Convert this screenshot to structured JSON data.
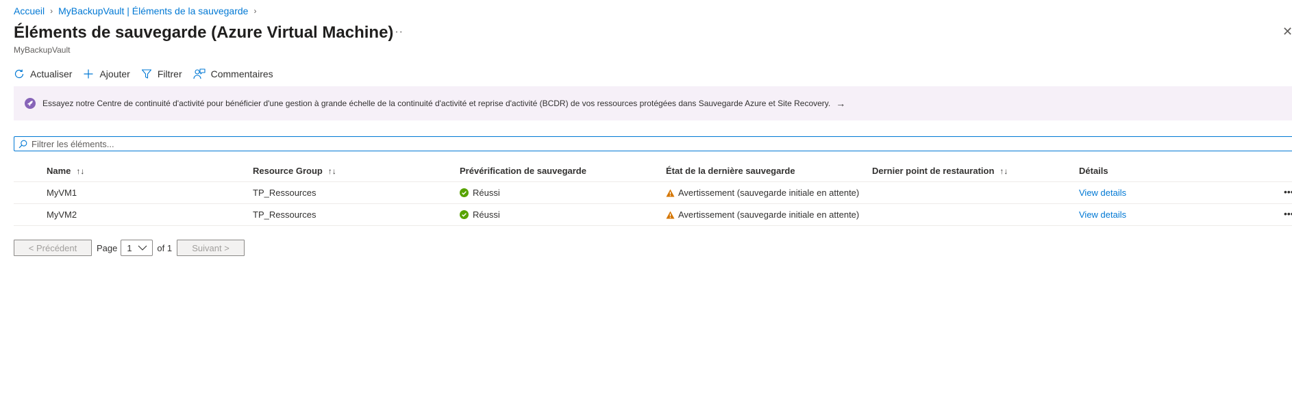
{
  "breadcrumb": {
    "home": "Accueil",
    "vault": "MyBackupVault | Éléments de la sauvegarde"
  },
  "header": {
    "title": "Éléments de sauvegarde (Azure Virtual Machine)",
    "subtitle": "MyBackupVault",
    "more": "···"
  },
  "toolbar": {
    "refresh": "Actualiser",
    "add": "Ajouter",
    "filter": "Filtrer",
    "feedback": "Commentaires"
  },
  "banner": {
    "text": "Essayez notre Centre de continuité d'activité pour bénéficier d'une gestion à grande échelle de la continuité d'activité et reprise d'activité (BCDR) de vos ressources protégées dans Sauvegarde Azure et Site Recovery."
  },
  "filter": {
    "placeholder": "Filtrer les éléments..."
  },
  "table": {
    "columns": [
      "Name",
      "Resource Group",
      "Prévérification de sauvegarde",
      "État de la dernière sauvegarde",
      "Dernier point de restauration",
      "Détails"
    ],
    "rows": [
      {
        "name": "MyVM1",
        "resource_group": "TP_Ressources",
        "precheck": "Réussi",
        "last_backup": "Avertissement (sauvegarde initiale en attente)",
        "restore_point": "",
        "details": "View details"
      },
      {
        "name": "MyVM2",
        "resource_group": "TP_Ressources",
        "precheck": "Réussi",
        "last_backup": "Avertissement (sauvegarde initiale en attente)",
        "restore_point": "",
        "details": "View details"
      }
    ]
  },
  "pager": {
    "prev": "< Précédent",
    "page_label": "Page",
    "page_value": "1",
    "of_label": "of 1",
    "next": "Suivant >"
  },
  "icons": {
    "refresh": "refresh-icon",
    "add": "plus-icon",
    "filter": "funnel-icon",
    "feedback": "feedback-icon",
    "banner": "rocket-icon",
    "search": "search-icon",
    "success": "checkmark-circle-icon",
    "warning": "warning-triangle-icon"
  },
  "colors": {
    "accent": "#0078d4",
    "success": "#57a300",
    "warning": "#d47500",
    "banner_bg": "#f6f0f8",
    "banner_icon": "#8764b8"
  }
}
